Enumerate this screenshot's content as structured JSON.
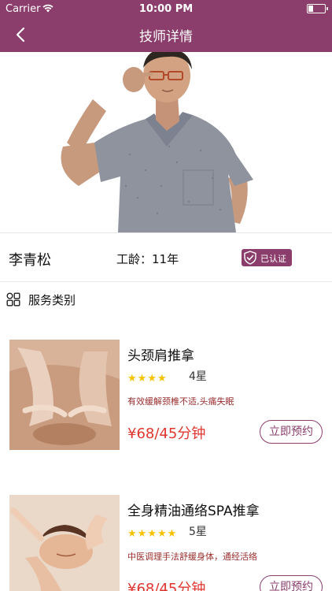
{
  "status_bar": {
    "carrier": "Carrier",
    "time": "10:00 PM"
  },
  "nav": {
    "title": "技师详情"
  },
  "technician": {
    "name": "李青松",
    "years_label": "工龄：11年",
    "verified_label": "已认证"
  },
  "section": {
    "label": "服务类别"
  },
  "services": [
    {
      "name": "头颈肩推拿",
      "stars": 4,
      "rating_label": "4星",
      "description": "有效缓解颈椎不适,头痛失眠",
      "price": "¥68/45分钟",
      "book_label": "立即预约"
    },
    {
      "name": "全身精油通络SPA推拿",
      "stars": 5,
      "rating_label": "5星",
      "description": "中医调理手法舒缓身体，通经活络",
      "price": "¥68/45分钟",
      "book_label": "立即预约"
    }
  ],
  "colors": {
    "brand": "#8b3d6b",
    "price": "#e0362f",
    "star": "#f6c200",
    "description": "#9a2d2d"
  },
  "icons": {
    "back": "chevron-left-icon",
    "wifi": "wifi-icon",
    "battery": "battery-icon",
    "verified": "shield-check-icon",
    "category": "grid-icon"
  }
}
